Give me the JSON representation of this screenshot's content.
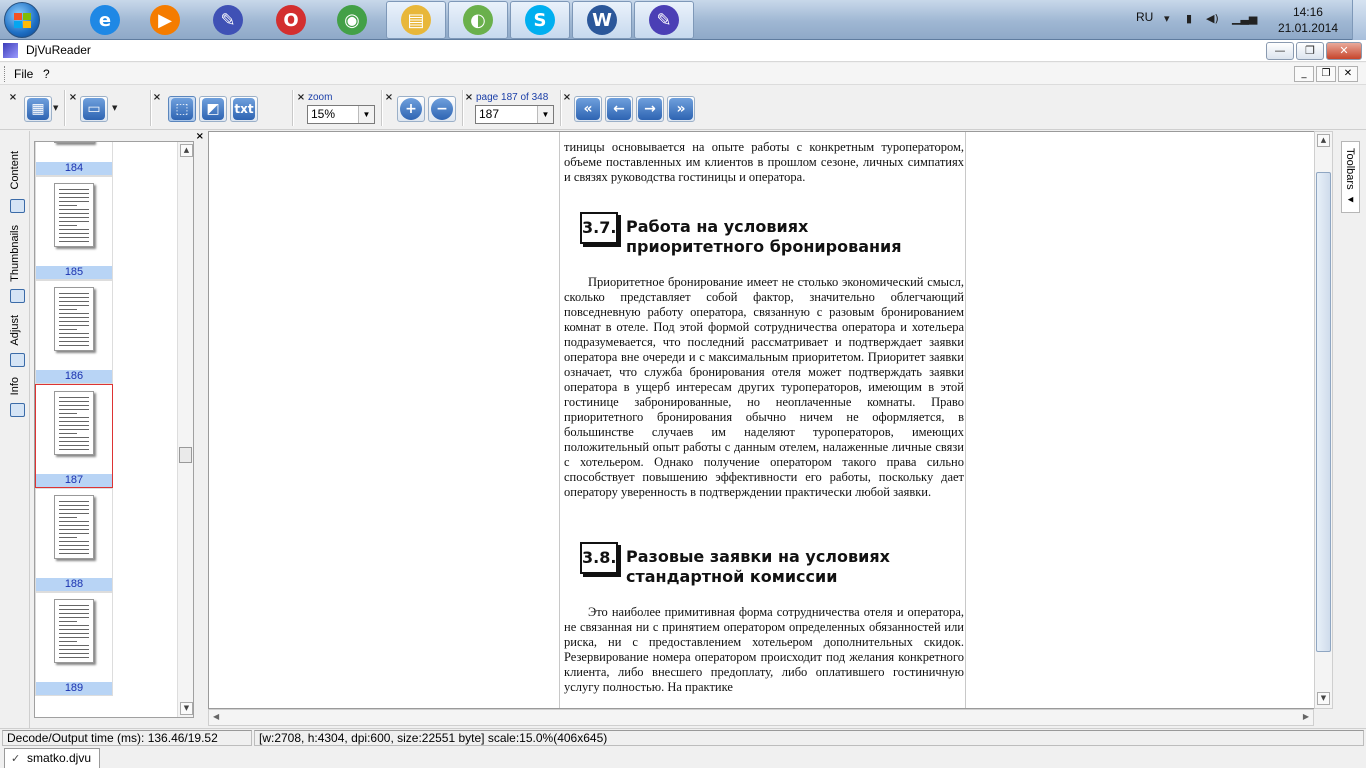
{
  "taskbar": {
    "apps": [
      {
        "name": "internet-explorer-icon",
        "glyph": "e",
        "color": "#1e88e5"
      },
      {
        "name": "media-player-icon",
        "glyph": "▶",
        "color": "#f57c00"
      },
      {
        "name": "paint-tool-icon",
        "glyph": "✎",
        "color": "#3f51b5"
      },
      {
        "name": "opera-icon",
        "glyph": "O",
        "color": "#d32f2f"
      },
      {
        "name": "chrome-icon",
        "glyph": "◉",
        "color": "#43a047"
      },
      {
        "name": "explorer-folder-icon",
        "glyph": "▤",
        "color": "#e8b73a"
      },
      {
        "name": "app-green-icon",
        "glyph": "◐",
        "color": "#6ab04c"
      },
      {
        "name": "skype-icon",
        "glyph": "S",
        "color": "#00aff0"
      },
      {
        "name": "word-icon",
        "glyph": "W",
        "color": "#2b579a"
      },
      {
        "name": "djvureader-icon",
        "glyph": "✎",
        "color": "#4b3fb5"
      }
    ],
    "lang": "RU",
    "time": "14:16",
    "date": "21.01.2014"
  },
  "window": {
    "title": "DjVuReader",
    "min": "—",
    "max": "❐",
    "close": "✕"
  },
  "menu": {
    "file": "File",
    "help": "?"
  },
  "toolbar": {
    "close_glyph": "×",
    "zoom_label": "zoom",
    "zoom_value": "15%",
    "page_label": "page 187 of 348",
    "page_value": "187",
    "txt_label": "txt",
    "zoom_in": "+",
    "zoom_out": "−",
    "first": "«",
    "prev": "←",
    "next": "→",
    "last": "»"
  },
  "sidetabs": {
    "content": "Content",
    "thumbnails": "Thumbnails",
    "adjust": "Adjust",
    "info": "Info"
  },
  "thumbnails": [
    {
      "num": "184",
      "selected": false
    },
    {
      "num": "185",
      "selected": false
    },
    {
      "num": "186",
      "selected": false
    },
    {
      "num": "187",
      "selected": true
    },
    {
      "num": "188",
      "selected": false
    },
    {
      "num": "189",
      "selected": false
    }
  ],
  "document": {
    "intro": "тиницы основывается на опыте работы с конкретным туропера­то­ром, объеме поставленных им клиентов в прошлом сезоне, лич­ных симпатиях и связях руководства гостиницы и оператора.",
    "sec1_num": "3.7.",
    "sec1_title": "Работа на условиях приоритетного бронирования",
    "sec1_text": "Приоритетное бронирование имеет не столько экономический смысл, сколько представляет собой фактор, значительно облегча­ющий повседневную работу оператора, связанную с разовым бро­нированием комнат в отеле. Под этой формой сотрудничества опе­ратора и хотельера подразумевается, что последний рассматривает и подтверждает заявки оператора вне очереди и с максимальным приоритетом. Приоритет заявки означает, что служба бронирова­ния отеля может подтверждать заявки оператора в ущерб интересам других туроператоров, имеющим в этой гостинице забронирован­ные, но неоплаченные комнаты. Право приоритетного брониро­вания обычно ничем не оформляется, в большинстве случаев им наделяют туроператоров, имеющих положительный опыт работы с данным отелем, налаженные личные связи с хотельером. Однако получение оператором такого права сильно способствует повыше­нию эффективности его работы, поскольку дает оператору уверен­ность в подтверждении практически любой заявки.",
    "sec2_num": "3.8.",
    "sec2_title": "Разовые заявки на условиях стандартной комиссии",
    "sec2_text": "Это наиболее примитивная форма сотрудничества отеля и опе­ратора, не связанная ни с принятием оператором определенных обязанностей или риска, ни с предоставлением хотельером допол­нительных скидок. Резервирование номера оператором происхо­дит под желания конкретного клиента, либо внесшего предоплату, либо оплатившего гостиничную услугу полностью. На практике"
  },
  "righttabs": {
    "toolbars": "Toolbars"
  },
  "status": {
    "decode": "Decode/Output time (ms): 136.46/19.52",
    "info": "[w:2708, h:4304, dpi:600, size:22551 byte] scale:15.0%(406x645)"
  },
  "tabs": {
    "doc": "smatko.djvu"
  }
}
